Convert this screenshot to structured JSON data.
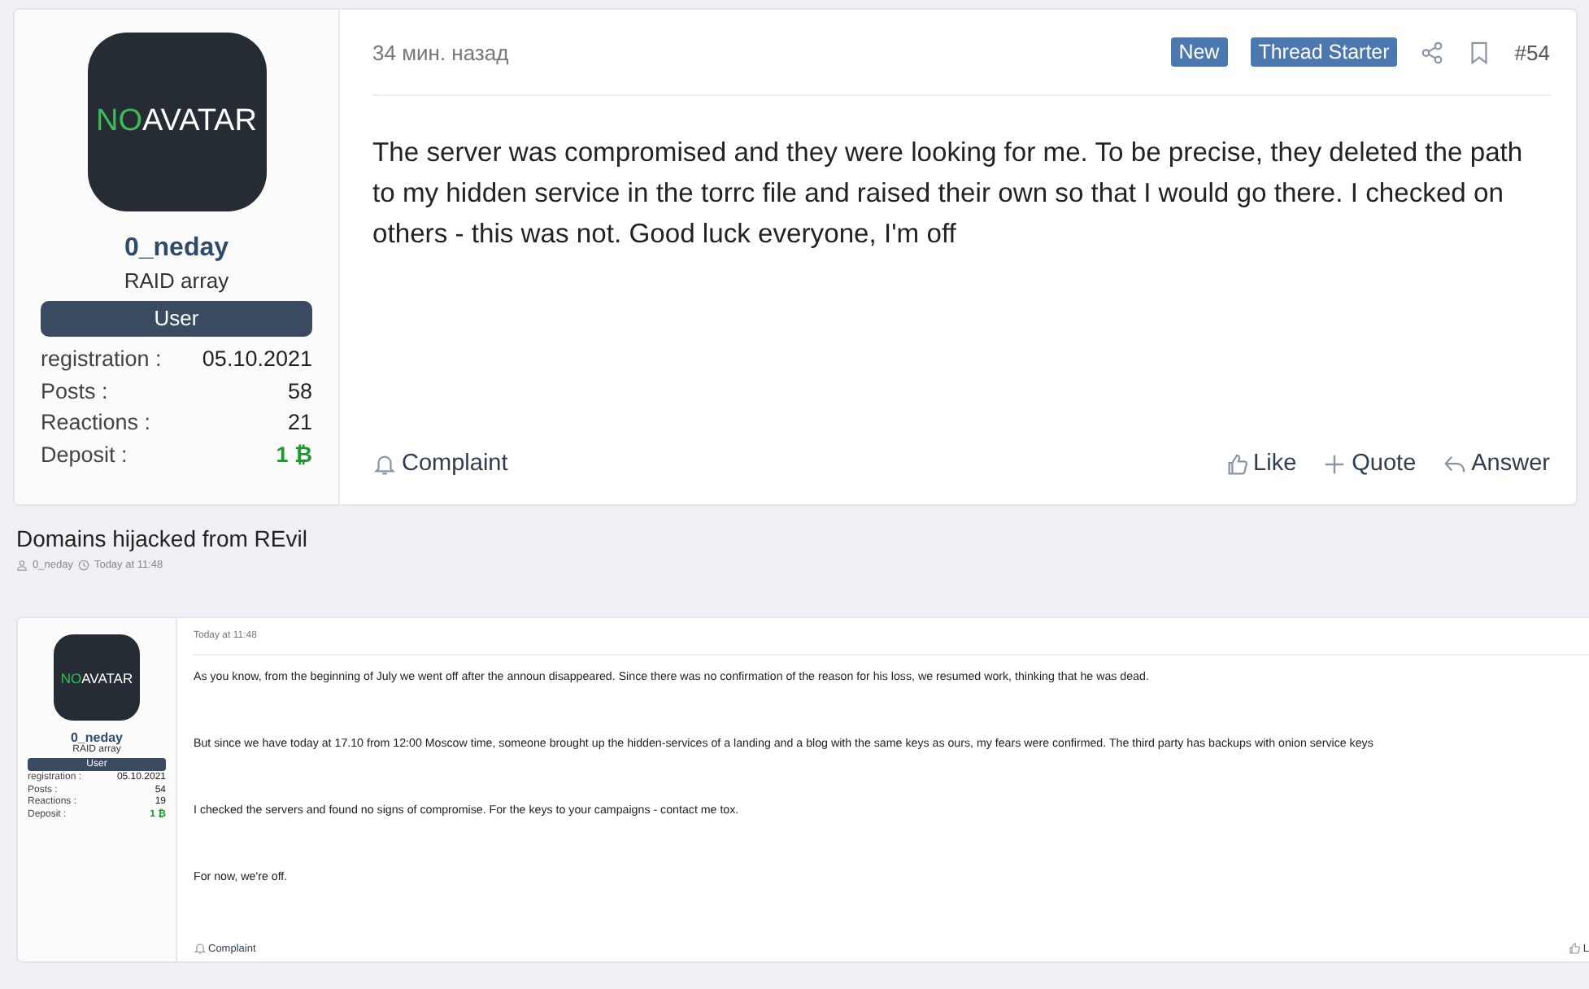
{
  "top_post": {
    "author": {
      "avatar": {
        "accent": "NO",
        "text": "AVATAR"
      },
      "name": "0_neday",
      "title": "RAID array",
      "group": "User",
      "stats": [
        {
          "label": "registration :",
          "value": "05.10.2021",
          "kind": "plain"
        },
        {
          "label": "Posts :",
          "value": "58",
          "kind": "plain"
        },
        {
          "label": "Reactions :",
          "value": "21",
          "kind": "plain"
        },
        {
          "label": "Deposit :",
          "value": "1 ₿",
          "kind": "deposit"
        }
      ]
    },
    "time": "34 мин. назад",
    "badges": [
      "New",
      "Thread Starter"
    ],
    "number": "#54",
    "paragraphs": [
      "The server was compromised and they were looking for me. To be precise, they deleted the path to my hidden service in the torrc file and raised their own so that I would go there. I checked on others - this was not. Good luck everyone, I'm off"
    ],
    "complaint": "Complaint",
    "actions": [
      {
        "kind": "like",
        "label": "Like"
      },
      {
        "kind": "quote",
        "label": "Quote"
      },
      {
        "kind": "answer",
        "label": "Answer"
      }
    ]
  },
  "thread": {
    "title": "Domains hijacked from REvil",
    "author": "0_neday",
    "time": "Today at 11:48"
  },
  "thread_post": {
    "author": {
      "avatar": {
        "accent": "NO",
        "text": "AVATAR"
      },
      "name": "0_neday",
      "title": "RAID array",
      "group": "User",
      "stats": [
        {
          "label": "registration :",
          "value": "05.10.2021",
          "kind": "plain"
        },
        {
          "label": "Posts :",
          "value": "54",
          "kind": "plain"
        },
        {
          "label": "Reactions :",
          "value": "19",
          "kind": "plain"
        },
        {
          "label": "Deposit :",
          "value": "1 ₿",
          "kind": "deposit"
        }
      ]
    },
    "time": "Today at 11:48",
    "paragraphs": [
      "As you know, from the beginning of July we went off after the announ disappeared. Since there was no confirmation of the reason for his loss, we resumed work, thinking that he was dead.",
      "But since we have today at 17.10 from 12:00 Moscow time, someone brought up the hidden-services of a landing and a blog with the same keys as ours, my fears were confirmed. The third party has backups with onion service keys",
      "I checked the servers and found no signs of compromise. For the keys to your campaigns - contact me tox.",
      "For now, we're off."
    ],
    "complaint": "Complaint",
    "actions": [
      {
        "kind": "like",
        "label": "L"
      }
    ]
  }
}
